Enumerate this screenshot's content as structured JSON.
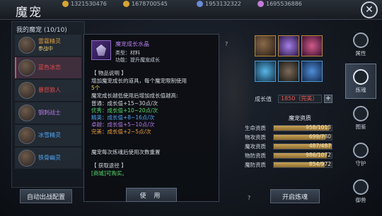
{
  "header": {
    "title": "魔宠",
    "currencies": [
      {
        "icon": "gold-coin-icon",
        "value": "1321530476"
      },
      {
        "icon": "silver-coin-icon",
        "value": "1678700545"
      },
      {
        "icon": "diamond-icon",
        "value": "1953132322"
      },
      {
        "icon": "gem-icon",
        "value": "1695536886"
      }
    ]
  },
  "pet_list": {
    "heading": "我的魔宠 (10/10)",
    "pets": [
      {
        "name": "雷霆精灵",
        "tag": "参战中",
        "selected": false
      },
      {
        "name": "蓝色冰恋",
        "tag": "",
        "selected": true
      },
      {
        "name": "暴怒狼人",
        "tag": "",
        "selected": false
      },
      {
        "name": "钢刺战士",
        "tag": "",
        "selected": false
      },
      {
        "name": "冰雪精灵",
        "tag": "",
        "selected": false
      },
      {
        "name": "铁骨幽灵",
        "tag": "",
        "selected": false
      }
    ],
    "auto_button": "自动出战配置"
  },
  "tooltip": {
    "item_name": "魔宠成长水晶",
    "type_line": "类型：材料",
    "func_line": "功能：提升魔宠成长",
    "desc_title": "【 物品说明 】",
    "desc_lines": [
      "增加魔宠成长的道具，每个魔宠限制使用",
      "5个",
      "魔宠成长越低使用后增加成长值越高:"
    ],
    "grades": [
      {
        "label": "普通：成长值+15~30点/次",
        "color": "plain"
      },
      {
        "label": "优秀：成长值+10~20点/次",
        "color": "green"
      },
      {
        "label": "精英：成长值+8~16点/次",
        "color": "blue"
      },
      {
        "label": "卓越：成长值+5~10点/次",
        "color": "purple"
      },
      {
        "label": "完美：成长值+2~5点/次",
        "color": "orange"
      }
    ],
    "reset_note": "魔宠每次炼魂后使用次数重置",
    "source_title": "【 获取途径 】",
    "source_text": "[商城]可购买。",
    "use_button": "使 用"
  },
  "growth": {
    "label": "成长值",
    "value": "1850（完美）",
    "plus": "+"
  },
  "aptitude": {
    "title": "魔宠资质",
    "rows": [
      {
        "label": "生命资质",
        "value": "958/1013",
        "ratio": 0.946
      },
      {
        "label": "物攻资质",
        "value": "699/780",
        "ratio": 0.896
      },
      {
        "label": "魔攻资质",
        "value": "487/487",
        "ratio": 1.0
      },
      {
        "label": "物防资质",
        "value": "986/1072",
        "ratio": 0.92
      },
      {
        "label": "魔防资质",
        "value": "854/972",
        "ratio": 0.879
      }
    ]
  },
  "start_button": "开启炼魂",
  "help_mark": "?",
  "close_mark": "✕",
  "tabs": [
    {
      "label": "属性",
      "icon": "attribute-icon",
      "active": false
    },
    {
      "label": "炼魂",
      "icon": "soul-refine-icon",
      "active": true
    },
    {
      "label": "图鉴",
      "icon": "codex-icon",
      "active": false
    },
    {
      "label": "守护",
      "icon": "guard-icon",
      "active": false
    },
    {
      "label": "御兽",
      "icon": "beast-taming-icon",
      "active": false
    }
  ],
  "colors": {
    "accent_red": "#e8534d",
    "green": "#58d96b",
    "blue": "#4fa4f2",
    "purple": "#b67be8",
    "orange": "#f0a040"
  }
}
